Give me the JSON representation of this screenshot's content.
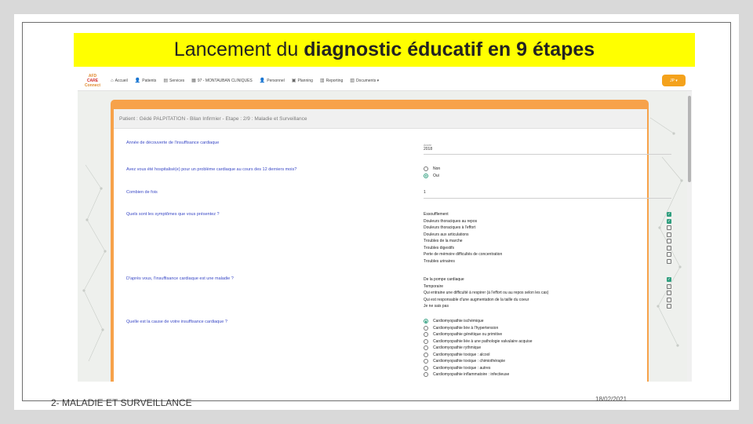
{
  "slide": {
    "title_regular": "Lancement du",
    "title_bold": "diagnostic éducatif en 9 étapes",
    "footer_left": "2- MALADIE ET SURVEILLANCE",
    "footer_date": "18/02/2021"
  },
  "app": {
    "logo_lines": [
      "AFD",
      "CARE",
      "Connect"
    ],
    "nav": [
      {
        "icon": "home-icon",
        "glyph": "⌂",
        "label": "Accueil"
      },
      {
        "icon": "patients-icon",
        "glyph": "👤",
        "label": "Patients"
      },
      {
        "icon": "services-icon",
        "glyph": "▤",
        "label": "Services"
      },
      {
        "icon": "building-icon",
        "glyph": "▦",
        "label": "97 - MONTAUBAN CLINIQUES"
      },
      {
        "icon": "user-icon",
        "glyph": "👤",
        "label": "Personnel"
      },
      {
        "icon": "calendar-icon",
        "glyph": "▣",
        "label": "Planning"
      },
      {
        "icon": "reports-icon",
        "glyph": "▥",
        "label": "Reporting"
      },
      {
        "icon": "documents-icon",
        "glyph": "▧",
        "label": "Documents ▾"
      }
    ],
    "user_chip": "JP ▾",
    "colors": {
      "accent": "#f7a24a",
      "highlight": "#ffff00",
      "check": "#2f9e7e",
      "question": "#3a49c6"
    }
  },
  "form": {
    "header": "Patient : Gédé PALPITATION - Bilan Infirmier - Etape : 2/9 : Maladie et Surveillance",
    "q1": {
      "label": "Année de découverte de l'insuffisance cardiaque",
      "field_label": "Année",
      "field_value": "2018"
    },
    "q2": {
      "label": "Avez vous été hospitalisé(e) pour un problème cardiaque au cours des 12 derniers mois?",
      "options": [
        {
          "label": "Non",
          "selected": false
        },
        {
          "label": "Oui",
          "selected": true
        }
      ]
    },
    "q3": {
      "label": "Combien de fois",
      "field_value": "1"
    },
    "q4": {
      "label": "Quels sont les symptômes que vous présentez ?",
      "options": [
        {
          "label": "Essoufflement",
          "checked": true
        },
        {
          "label": "Douleurs thoraciques au repos",
          "checked": true
        },
        {
          "label": "Douleurs thoraciques à l'effort",
          "checked": false
        },
        {
          "label": "Douleurs aux articulations",
          "checked": false
        },
        {
          "label": "Troubles de la marche",
          "checked": false
        },
        {
          "label": "Troubles digestifs",
          "checked": false
        },
        {
          "label": "Perte de mémoire difficultés de concentration",
          "checked": false
        },
        {
          "label": "Troubles urinaires",
          "checked": false
        }
      ]
    },
    "q5": {
      "label": "D'après vous, l'insuffisance cardiaque est une maladie ?",
      "options": [
        {
          "label": "De la pompe cardiaque",
          "checked": true
        },
        {
          "label": "Temporaire",
          "checked": false
        },
        {
          "label": "Qui entraine une difficulté à respirer (à l'effort ou au repos selon les cas)",
          "checked": false
        },
        {
          "label": "Qui est responsable d'une augmentation de la taille du coeur",
          "checked": false
        },
        {
          "label": "Je ne sais pas",
          "checked": false
        }
      ]
    },
    "q6": {
      "label": "Quelle est la cause de votre insuffisance cardiaque ?",
      "options": [
        {
          "label": "Cardiomyopathie ischémique",
          "selected": true
        },
        {
          "label": "Cardiomyopathie liée à l'hypertension",
          "selected": false
        },
        {
          "label": "Cardiomyopathie génétique ou primitive",
          "selected": false
        },
        {
          "label": "Cardiomyopathie liée à une pathologie valvulaire acquise",
          "selected": false
        },
        {
          "label": "Cardiomyopathie rythmique",
          "selected": false
        },
        {
          "label": "Cardiomyopathie toxique : alcool",
          "selected": false
        },
        {
          "label": "Cardiomyopathie toxique : chimiothérapie",
          "selected": false
        },
        {
          "label": "Cardiomyopathie toxique : autres",
          "selected": false
        },
        {
          "label": "Cardiomyopathie inflammatoire : infectieuse",
          "selected": false
        }
      ]
    }
  }
}
